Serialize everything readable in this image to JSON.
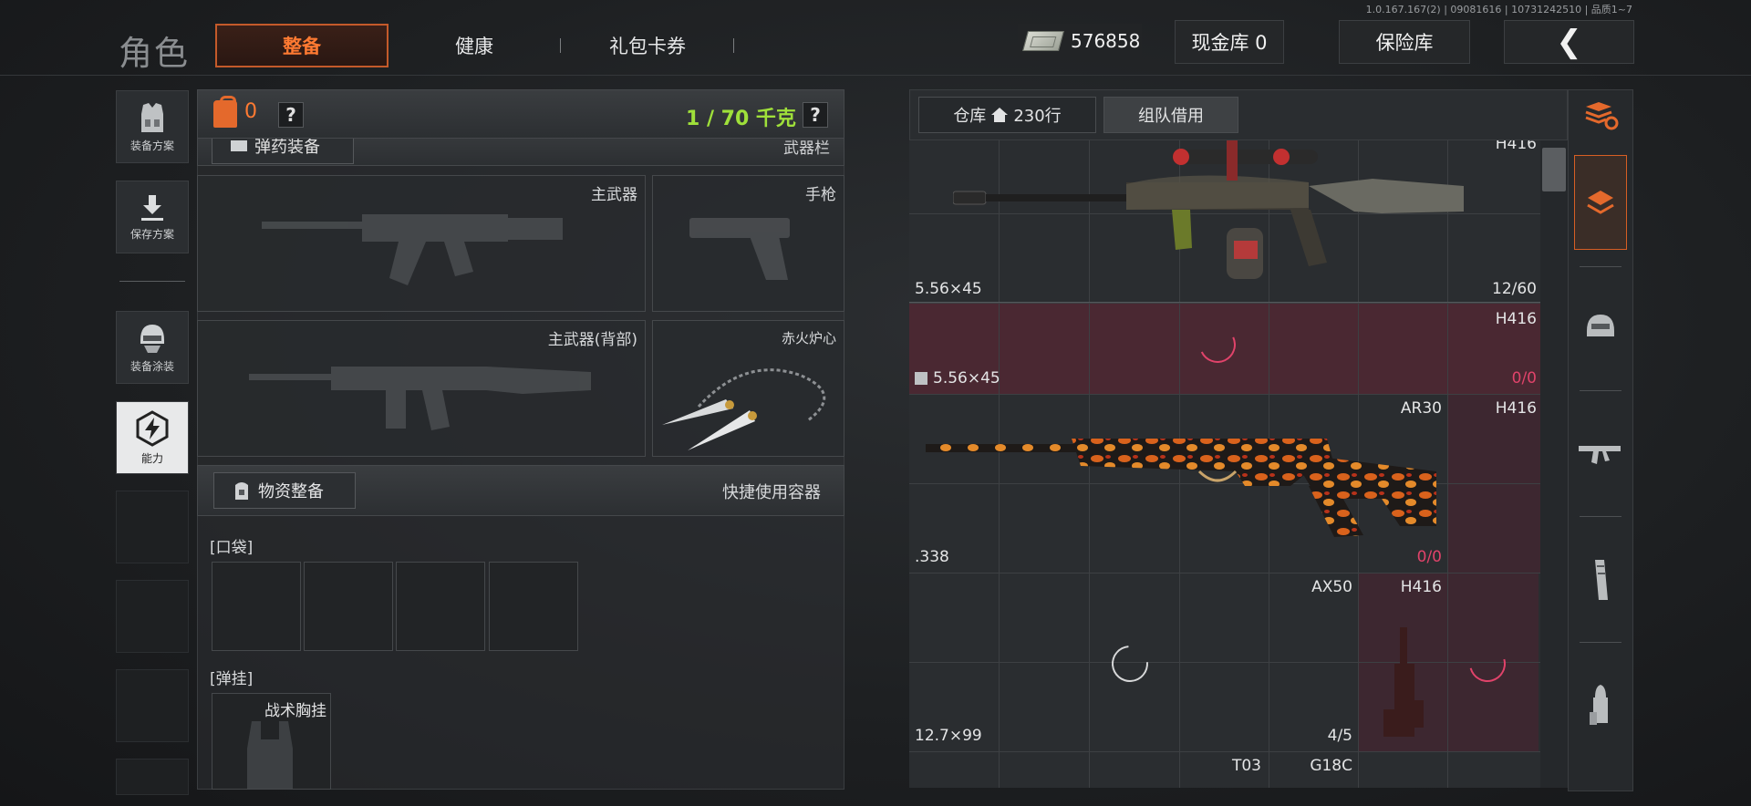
{
  "version": "1.0.167.167(2) | 09081616 | 10731242510 | 品质1~7",
  "header": {
    "title": "角色",
    "tabs": [
      {
        "label": "整备",
        "active": true
      },
      {
        "label": "健康",
        "active": false
      },
      {
        "label": "礼包卡券",
        "active": false
      }
    ],
    "cash": "576858",
    "cash_vault": "现金库 0",
    "insurance": "保险库"
  },
  "sidebar": {
    "items": [
      {
        "label": "装备方案",
        "icon": "vest-icon"
      },
      {
        "label": "保存方案",
        "icon": "download-icon"
      },
      {
        "label": "装备涂装",
        "icon": "helmet-icon"
      },
      {
        "label": "能力",
        "icon": "ability-icon",
        "active": true
      }
    ]
  },
  "equipment": {
    "weight_count": "0",
    "weight": "1 / 70 千克",
    "help": "?",
    "partial_section_label": "弹药装备",
    "partial_section_right": "武器栏",
    "slots": {
      "primary": "主武器",
      "pistol": "手枪",
      "primary_back": "主武器(背部)",
      "melee": "赤火炉心"
    },
    "supplies_title": "物资整备",
    "quick_use": "快捷使用容器",
    "pockets_label": "[口袋]",
    "rig_label": "[弹挂]",
    "rig_item": "战术胸挂"
  },
  "warehouse": {
    "tab_label": "仓库",
    "rows": "230行",
    "team_borrow": "组队借用",
    "items": [
      {
        "caliber": "5.56×45",
        "name": "H416",
        "ammo": "12/60"
      },
      {
        "caliber": "5.56×45",
        "name": "H416",
        "ammo": "0/0"
      },
      {
        "caliber": ".338",
        "name": "AR30",
        "ammo": "0/0",
        "side_name": "H416"
      },
      {
        "caliber": "12.7×99",
        "name": "AX50",
        "ammo": "4/5",
        "side_name": "H416"
      },
      {
        "name_a": "T03",
        "name_b": "G18C"
      }
    ]
  },
  "colors": {
    "accent": "#ff7a32",
    "weight_green": "#9fe03a",
    "ammo_empty": "#e0436a",
    "pink_bg": "#4a2832"
  }
}
